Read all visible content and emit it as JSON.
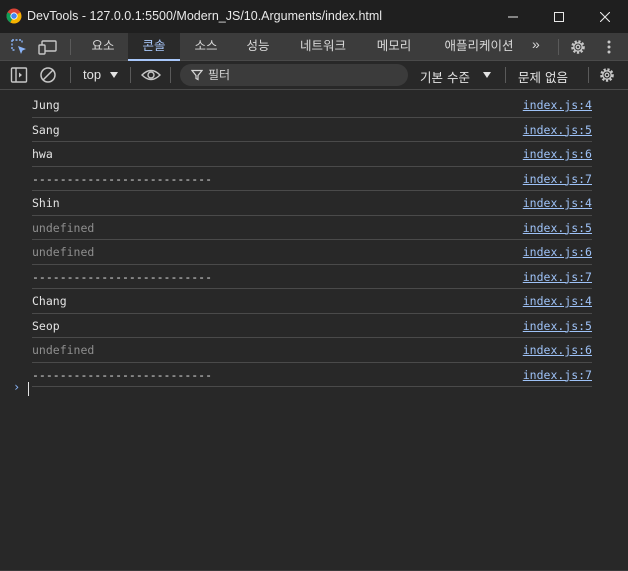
{
  "window": {
    "title": "DevTools - 127.0.0.1:5500/Modern_JS/10.Arguments/index.html",
    "minimize_icon": "minimize-icon",
    "maximize_icon": "maximize-icon",
    "close_icon": "close-icon"
  },
  "panels": {
    "tabs": [
      {
        "label": "요소",
        "active": false
      },
      {
        "label": "콘솔",
        "active": true
      },
      {
        "label": "소스",
        "active": false
      },
      {
        "label": "성능",
        "active": false
      },
      {
        "label": "네트워크",
        "active": false
      },
      {
        "label": "메모리",
        "active": false
      },
      {
        "label": "애플리케이션",
        "active": false
      }
    ],
    "more_label": "»",
    "accent": "#a8c7fa"
  },
  "toolbar": {
    "context": "top",
    "filter_placeholder": "필터",
    "levels_label": "기본 수준",
    "issues_label": "문제 없음"
  },
  "console": {
    "messages": [
      {
        "text": "Jung",
        "source": "index.js:4",
        "type": "log"
      },
      {
        "text": "Sang",
        "source": "index.js:5",
        "type": "log"
      },
      {
        "text": "hwa",
        "source": "index.js:6",
        "type": "log"
      },
      {
        "text": "--------------------------",
        "source": "index.js:7",
        "type": "log"
      },
      {
        "text": "Shin",
        "source": "index.js:4",
        "type": "log"
      },
      {
        "text": "undefined",
        "source": "index.js:5",
        "type": "undefined"
      },
      {
        "text": "undefined",
        "source": "index.js:6",
        "type": "undefined"
      },
      {
        "text": "--------------------------",
        "source": "index.js:7",
        "type": "log"
      },
      {
        "text": "Chang",
        "source": "index.js:4",
        "type": "log"
      },
      {
        "text": "Seop",
        "source": "index.js:5",
        "type": "log"
      },
      {
        "text": "undefined",
        "source": "index.js:6",
        "type": "undefined"
      },
      {
        "text": "--------------------------",
        "source": "index.js:7",
        "type": "log"
      }
    ],
    "prompt_symbol": "›"
  },
  "colors": {
    "background": "#282828",
    "link": "#9ec2f7",
    "undefined_text": "#8e8e8e"
  }
}
